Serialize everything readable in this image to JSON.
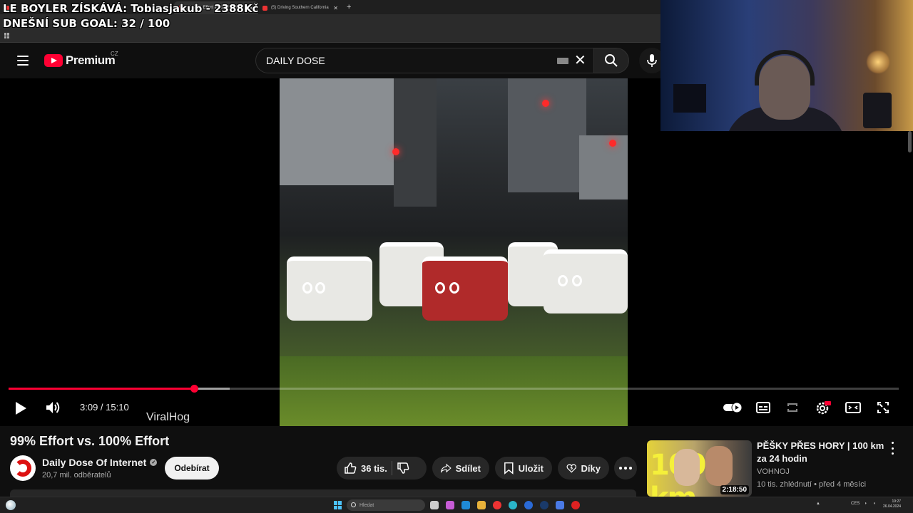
{
  "overlay": {
    "line1": "LE BOYLER ZÍSKÁVÁ: Tobiasjakub - 2388Kč",
    "line2": "DNEŠNÍ SUB GOAL: 32 / 100"
  },
  "browser": {
    "tabs": [
      {
        "label": "",
        "active": false
      },
      {
        "label": "",
        "active": false
      },
      {
        "label": "(5) 99% Effort vs. 100% Effort",
        "active": true
      },
      {
        "label": "(5) Driving Southern California",
        "active": false
      }
    ]
  },
  "header": {
    "logo_text": "Premium",
    "region": "CZ",
    "search_value": "DAILY DOSE"
  },
  "player": {
    "current_time": "3:09 / 15:10",
    "watermark": "ViralHog",
    "played_fraction": 0.208,
    "buffered_fraction": 0.248
  },
  "video_info": {
    "title": "99% Effort vs. 100% Effort",
    "channel": "Daily Dose Of Internet",
    "subscribers": "20,7 mil. odběratelů",
    "subscribe_label": "Odebírat",
    "likes": "36 tis.",
    "share_label": "Sdílet",
    "save_label": "Uložit",
    "thanks_label": "Díky"
  },
  "recommendation": {
    "title": "PĚŠKY PŘES HORY | 100 km za 24 hodin",
    "channel": "VOHNOJ",
    "meta": "10 tis. zhlédnutí • před 4 měsíci",
    "duration": "2:18:50",
    "thumb_text": "100 km"
  },
  "taskbar": {
    "search_placeholder": "Hledat",
    "language": "CES",
    "time": "19:27",
    "date": "26.04.2024"
  },
  "colors": {
    "accent": "#ff0033",
    "background": "#0f0f0f"
  }
}
